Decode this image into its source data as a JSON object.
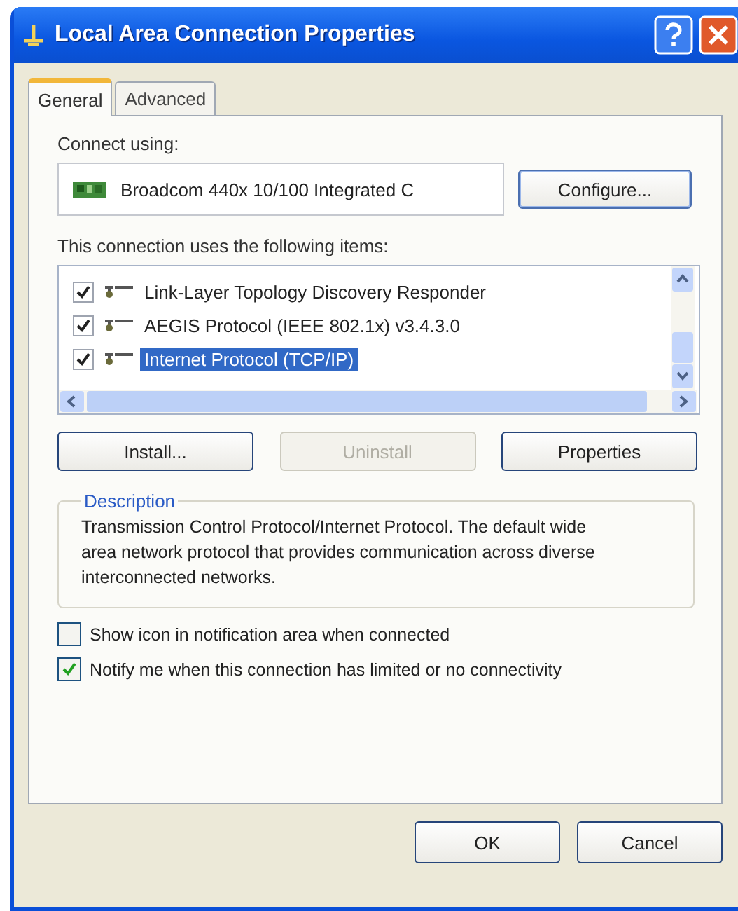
{
  "window": {
    "title": "Local Area Connection Properties"
  },
  "tabs": [
    {
      "label": "General",
      "selected": true
    },
    {
      "label": "Advanced",
      "selected": false
    }
  ],
  "connect_using": {
    "label": "Connect using:",
    "adapter": "Broadcom 440x 10/100 Integrated C",
    "button": "Configure..."
  },
  "items_label": "This connection uses the following items:",
  "items": [
    {
      "label": "Link-Layer Topology Discovery Responder",
      "checked": true,
      "selected": false
    },
    {
      "label": "AEGIS Protocol (IEEE 802.1x) v3.4.3.0",
      "checked": true,
      "selected": false
    },
    {
      "label": "Internet Protocol (TCP/IP)",
      "checked": true,
      "selected": true
    }
  ],
  "item_buttons": [
    {
      "label": "Install...",
      "disabled": false
    },
    {
      "label": "Uninstall",
      "disabled": true
    },
    {
      "label": "Properties",
      "disabled": false
    }
  ],
  "description": {
    "title": "Description",
    "text": "Transmission Control Protocol/Internet Protocol. The default wide area network protocol that provides communication across diverse interconnected networks."
  },
  "options": [
    {
      "label": "Show icon in notification area when connected",
      "checked": false
    },
    {
      "label": "Notify me when this connection has limited or no connectivity",
      "checked": true
    }
  ],
  "dialog_buttons": [
    "OK",
    "Cancel"
  ]
}
